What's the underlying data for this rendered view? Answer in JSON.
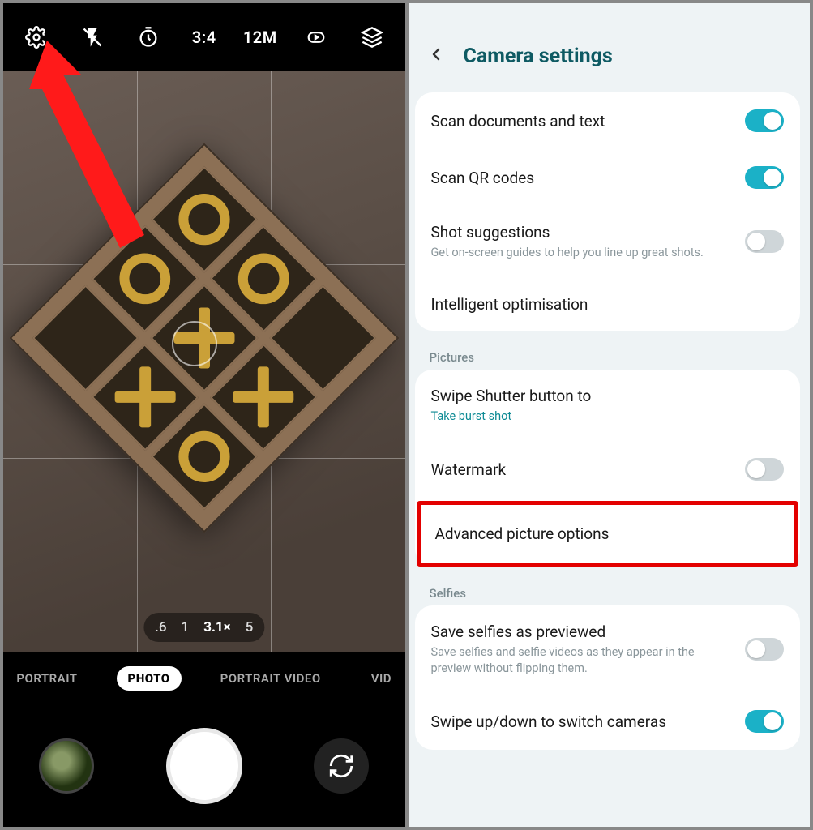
{
  "camera": {
    "topbar": {
      "aspect_ratio": "3:4",
      "resolution": "12M"
    },
    "zoom": {
      "levels": [
        ".6",
        "1",
        "3.1×",
        "5"
      ],
      "active_index": 2
    },
    "modes": {
      "items": [
        "PORTRAIT",
        "PHOTO",
        "PORTRAIT VIDEO",
        "VID"
      ],
      "active_index": 1
    }
  },
  "settings": {
    "title": "Camera settings",
    "group1": {
      "scan_docs": {
        "title": "Scan documents and text",
        "on": true
      },
      "scan_qr": {
        "title": "Scan QR codes",
        "on": true
      },
      "shot_sugg": {
        "title": "Shot suggestions",
        "sub": "Get on-screen guides to help you line up great shots.",
        "on": false
      },
      "intel_opt": {
        "title": "Intelligent optimisation"
      }
    },
    "pictures_label": "Pictures",
    "group2": {
      "swipe_shutter": {
        "title": "Swipe Shutter button to",
        "sub": "Take burst shot"
      },
      "watermark": {
        "title": "Watermark",
        "on": false
      },
      "adv_pic": {
        "title": "Advanced picture options"
      }
    },
    "selfies_label": "Selfies",
    "group3": {
      "save_selfies": {
        "title": "Save selfies as previewed",
        "sub": "Save selfies and selfie videos as they appear in the preview without flipping them.",
        "on": false
      },
      "swipe_switch": {
        "title": "Swipe up/down to switch cameras",
        "on": true
      }
    }
  }
}
